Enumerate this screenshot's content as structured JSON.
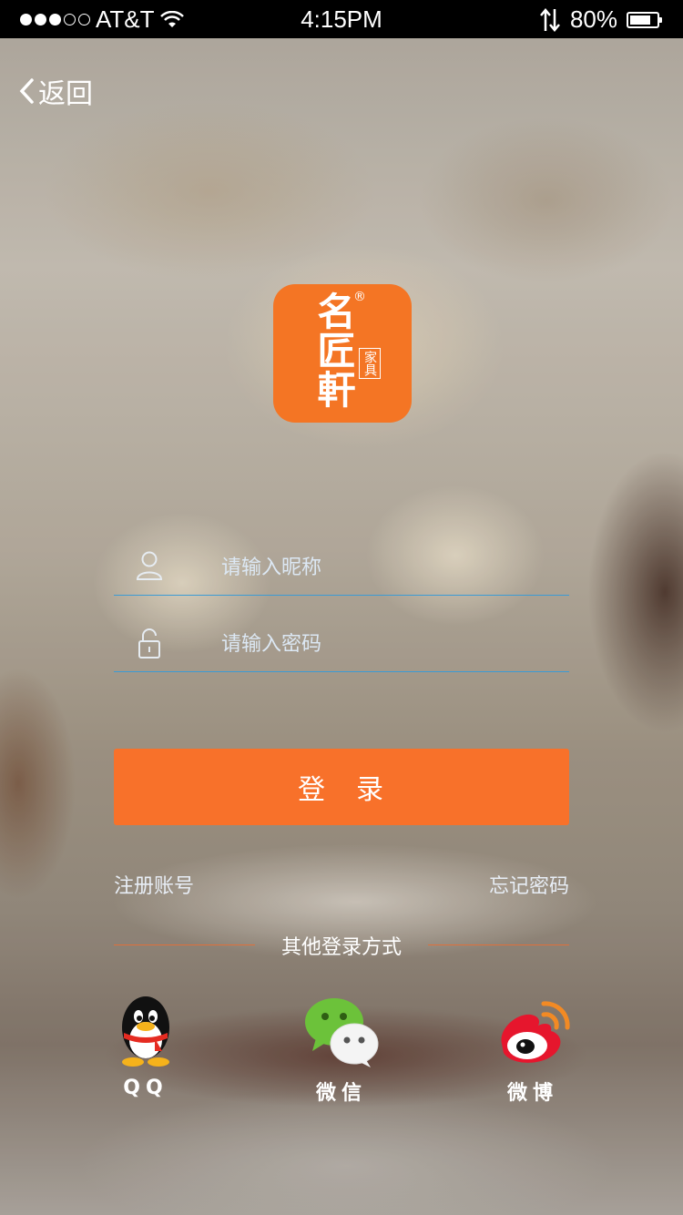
{
  "status_bar": {
    "carrier": "AT&T",
    "time": "4:15PM",
    "battery_percent": "80%",
    "battery_level": 0.8,
    "signal_bars": 3,
    "signal_total": 5
  },
  "nav": {
    "back_label": "返回"
  },
  "brand": {
    "name_main": "名匠軒",
    "name_sub": "家具",
    "registered_mark": "®",
    "color": "#f47524"
  },
  "form": {
    "nickname_placeholder": "请输入昵称",
    "nickname_value": "",
    "password_placeholder": "请输入密码",
    "password_value": "",
    "login_label": "登　录",
    "underline_color": "#3b9bd4"
  },
  "links": {
    "register": "注册账号",
    "forgot_password": "忘记密码"
  },
  "other_login": {
    "title": "其他登录方式",
    "providers": [
      {
        "label": "QQ",
        "icon": "qq-penguin-icon"
      },
      {
        "label": "微信",
        "icon": "wechat-icon"
      },
      {
        "label": "微博",
        "icon": "weibo-icon"
      }
    ]
  },
  "colors": {
    "accent": "#f8712a",
    "wechat_green": "#6cc23a",
    "weibo_red": "#e6162d"
  }
}
